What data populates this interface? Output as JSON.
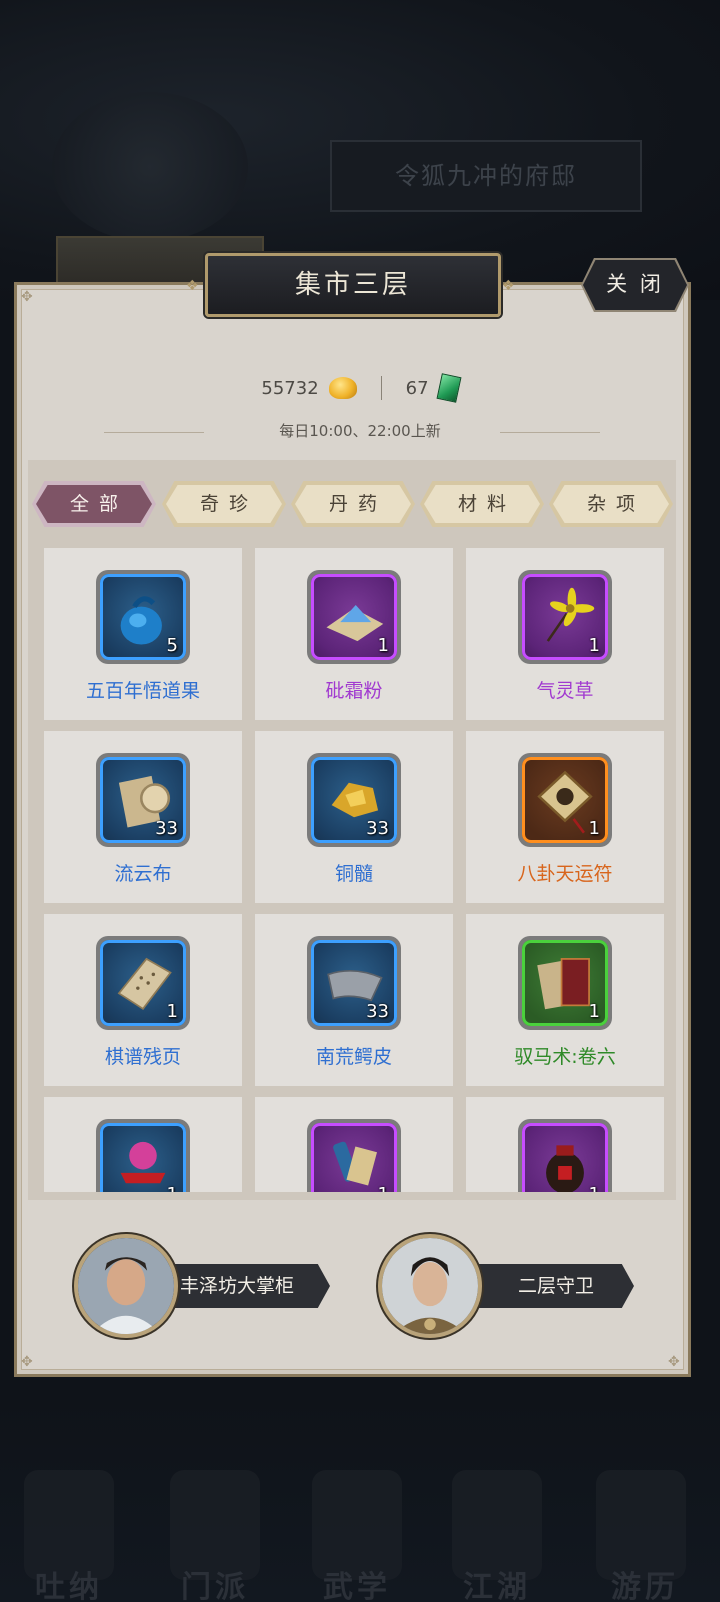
{
  "background": {
    "residence_title": "令狐九冲的府邸",
    "nav": [
      "吐纳",
      "门派",
      "武学",
      "江湖",
      "游历"
    ]
  },
  "panel": {
    "title": "集市三层",
    "close_label": "关 闭",
    "currency": {
      "gold_value": "55732",
      "gold_icon": "gold-ingot-icon",
      "jade_value": "67",
      "jade_icon": "jade-token-icon"
    },
    "refresh_text": "每日10:00、22:00上新"
  },
  "tabs": [
    {
      "label": "全部",
      "active": true
    },
    {
      "label": "奇珍",
      "active": false
    },
    {
      "label": "丹药",
      "active": false
    },
    {
      "label": "材料",
      "active": false
    },
    {
      "label": "杂项",
      "active": false
    }
  ],
  "items": [
    {
      "name": "五百年悟道果",
      "count": "5",
      "rarity": "blue",
      "icon": "fruit-pouch-icon"
    },
    {
      "name": "砒霜粉",
      "count": "1",
      "rarity": "purple",
      "icon": "powder-icon"
    },
    {
      "name": "气灵草",
      "count": "1",
      "rarity": "purple",
      "icon": "herb-icon"
    },
    {
      "name": "流云布",
      "count": "33",
      "rarity": "blue",
      "icon": "cloth-roll-icon"
    },
    {
      "name": "铜髓",
      "count": "33",
      "rarity": "blue",
      "icon": "copper-ore-icon"
    },
    {
      "name": "八卦天运符",
      "count": "1",
      "rarity": "orange",
      "icon": "bagua-talisman-icon"
    },
    {
      "name": "棋谱残页",
      "count": "1",
      "rarity": "blue",
      "icon": "torn-page-icon"
    },
    {
      "name": "南荒鳄皮",
      "count": "33",
      "rarity": "blue",
      "icon": "hide-icon"
    },
    {
      "name": "驭马术:卷六",
      "count": "1",
      "rarity": "green",
      "icon": "book-icon"
    },
    {
      "name": "",
      "count": "1",
      "rarity": "blue",
      "icon": "yarn-ball-icon"
    },
    {
      "name": "",
      "count": "1",
      "rarity": "purple",
      "icon": "scroll-icon"
    },
    {
      "name": "",
      "count": "1",
      "rarity": "purple",
      "icon": "wine-jar-icon"
    }
  ],
  "npcs": [
    {
      "name": "丰泽坊大掌柜",
      "icon": "shopkeeper-avatar"
    },
    {
      "name": "二层守卫",
      "icon": "guard-avatar"
    }
  ],
  "colors": {
    "rarity_blue": "#2f6fd1",
    "rarity_purple": "#a13ad0",
    "rarity_orange": "#d8651c",
    "rarity_green": "#2f8a28",
    "tab_active": "#7e5466"
  }
}
